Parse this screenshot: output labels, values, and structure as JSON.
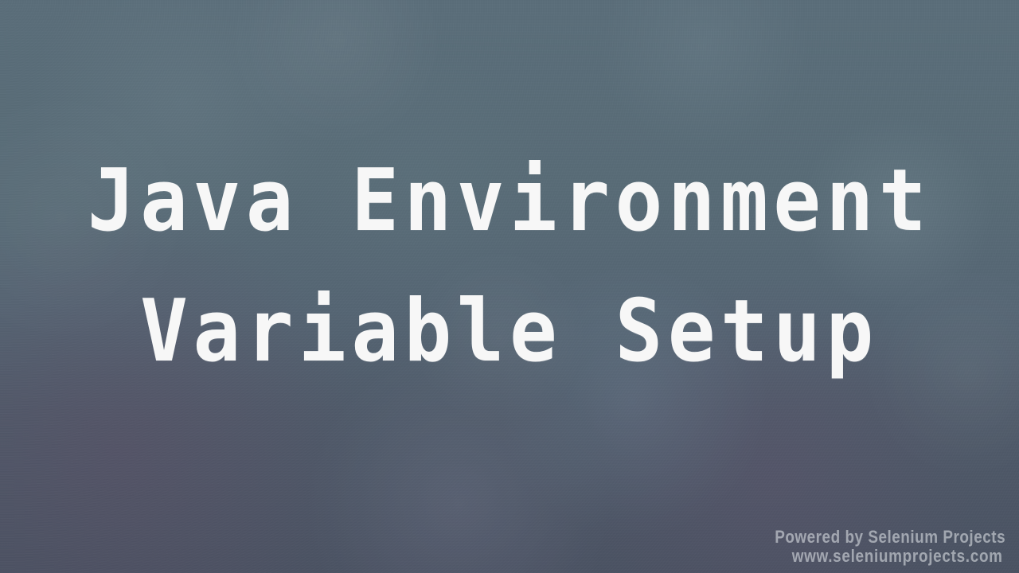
{
  "title": {
    "line1": "Java Environment",
    "line2": "Variable  Setup"
  },
  "footer": {
    "line1": "Powered by Selenium Projects",
    "line2": "www.seleniumprojects.com"
  },
  "colors": {
    "title_text": "#f7f7f7",
    "footer_text": "#b8c0c5",
    "background_primary": "#586b76",
    "background_accent": "#5d4e66"
  }
}
